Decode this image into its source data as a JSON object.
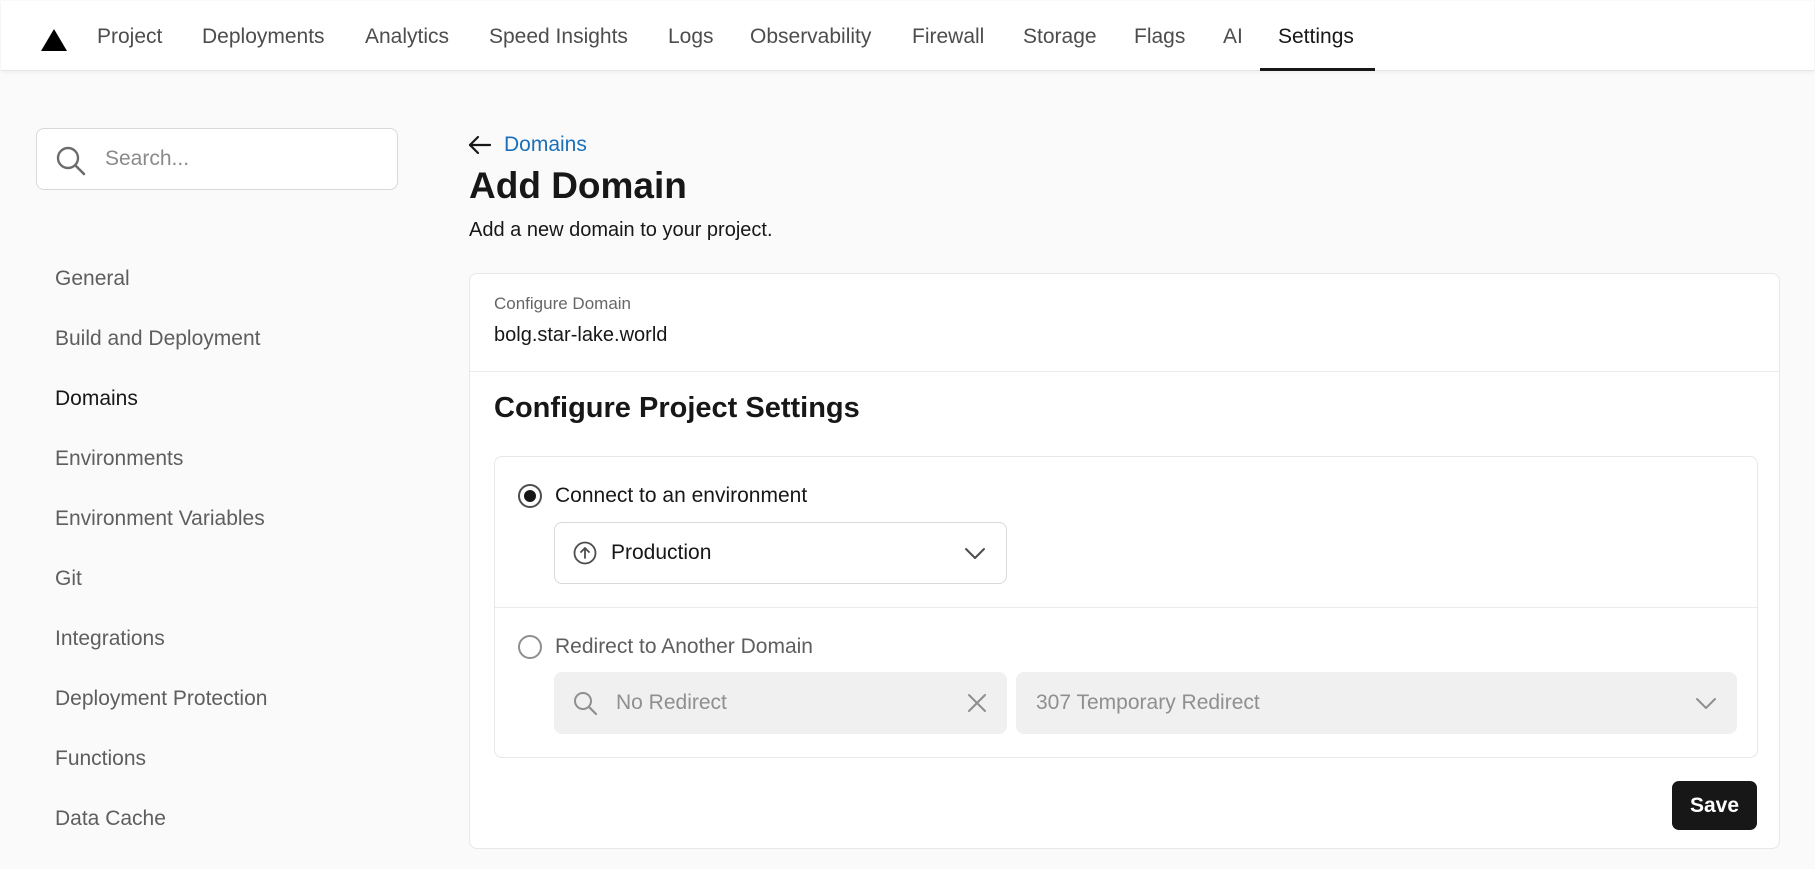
{
  "topnav": {
    "logo": "vercel-triangle-icon",
    "tabs": [
      {
        "label": "Project"
      },
      {
        "label": "Deployments"
      },
      {
        "label": "Analytics"
      },
      {
        "label": "Speed Insights"
      },
      {
        "label": "Logs"
      },
      {
        "label": "Observability"
      },
      {
        "label": "Firewall"
      },
      {
        "label": "Storage"
      },
      {
        "label": "Flags"
      },
      {
        "label": "AI"
      },
      {
        "label": "Settings"
      }
    ],
    "active_tab": "Settings"
  },
  "sidebar": {
    "search": {
      "placeholder": "Search...",
      "value": ""
    },
    "items": [
      {
        "label": "General"
      },
      {
        "label": "Build and Deployment"
      },
      {
        "label": "Domains"
      },
      {
        "label": "Environments"
      },
      {
        "label": "Environment Variables"
      },
      {
        "label": "Git"
      },
      {
        "label": "Integrations"
      },
      {
        "label": "Deployment Protection"
      },
      {
        "label": "Functions"
      },
      {
        "label": "Data Cache"
      }
    ],
    "active_item": "Domains"
  },
  "main": {
    "back_link": "Domains",
    "title": "Add Domain",
    "subtitle": "Add a new domain to your project.",
    "configure_domain": {
      "label": "Configure Domain",
      "value": "bolg.star-lake.world"
    },
    "project_settings": {
      "title": "Configure Project Settings",
      "connect_option": {
        "label": "Connect to an environment",
        "checked": true,
        "environment": "Production"
      },
      "redirect_option": {
        "label": "Redirect to Another Domain",
        "checked": false,
        "target_placeholder": "No Redirect",
        "redirect_type": "307 Temporary Redirect"
      }
    },
    "save_label": "Save"
  },
  "colors": {
    "accent_link": "#1a6fb8",
    "primary_button": "#171717",
    "background": "#fafafa"
  }
}
